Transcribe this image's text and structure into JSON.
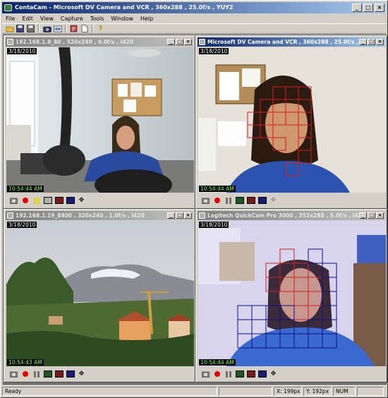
{
  "app": {
    "title": "ContaCam - Microsoft DV Camera and VCR , 360x288 , 25.0f/s , YUY2",
    "window_buttons": [
      "_",
      "□",
      "×"
    ]
  },
  "menu": [
    "File",
    "Edit",
    "View",
    "Capture",
    "Tools",
    "Window",
    "Help"
  ],
  "toolbar_icons": [
    "open-icon",
    "save-icon",
    "save-all-icon",
    "camera-icon",
    "snapshot-icon",
    "settings-icon",
    "document-icon",
    "help-icon"
  ],
  "help_glyph": "?",
  "cameras": [
    {
      "title": "192.168.1.9_80 , 320x240 , 4.0f/s , I420",
      "date": "3/18/2010",
      "time": "10:54:44 AM",
      "active": false,
      "paused": true
    },
    {
      "title": "Microsoft DV Camera and VCR , 360x288 , 25.0f/s , YUY2",
      "date": "3/18/2010",
      "time": "10:54:44 AM",
      "active": true,
      "paused": false
    },
    {
      "title": "192.168.1.19_8800 , 320x240 , 1.0f/s , I420",
      "date": "3/18/2010",
      "time": "10:54:43 AM",
      "active": false,
      "paused": false
    },
    {
      "title": "Logitech QuickCam Pro 3000 , 352x288 , 5.0f/s , I4...",
      "date": "3/18/2010",
      "time": "10:54:44 AM",
      "active": false,
      "paused": false
    }
  ],
  "cam_button_glyphs": {
    "move": "✥"
  },
  "status": {
    "text": "Ready",
    "x": "X: 199px",
    "y": "Y: 192px",
    "num": "NUM"
  },
  "colors": {
    "title_active": "#0a246a",
    "title_inactive": "#808080",
    "motion_red": "#d02020",
    "motion_blue": "#101080",
    "time_green": "#7cfc4c"
  }
}
